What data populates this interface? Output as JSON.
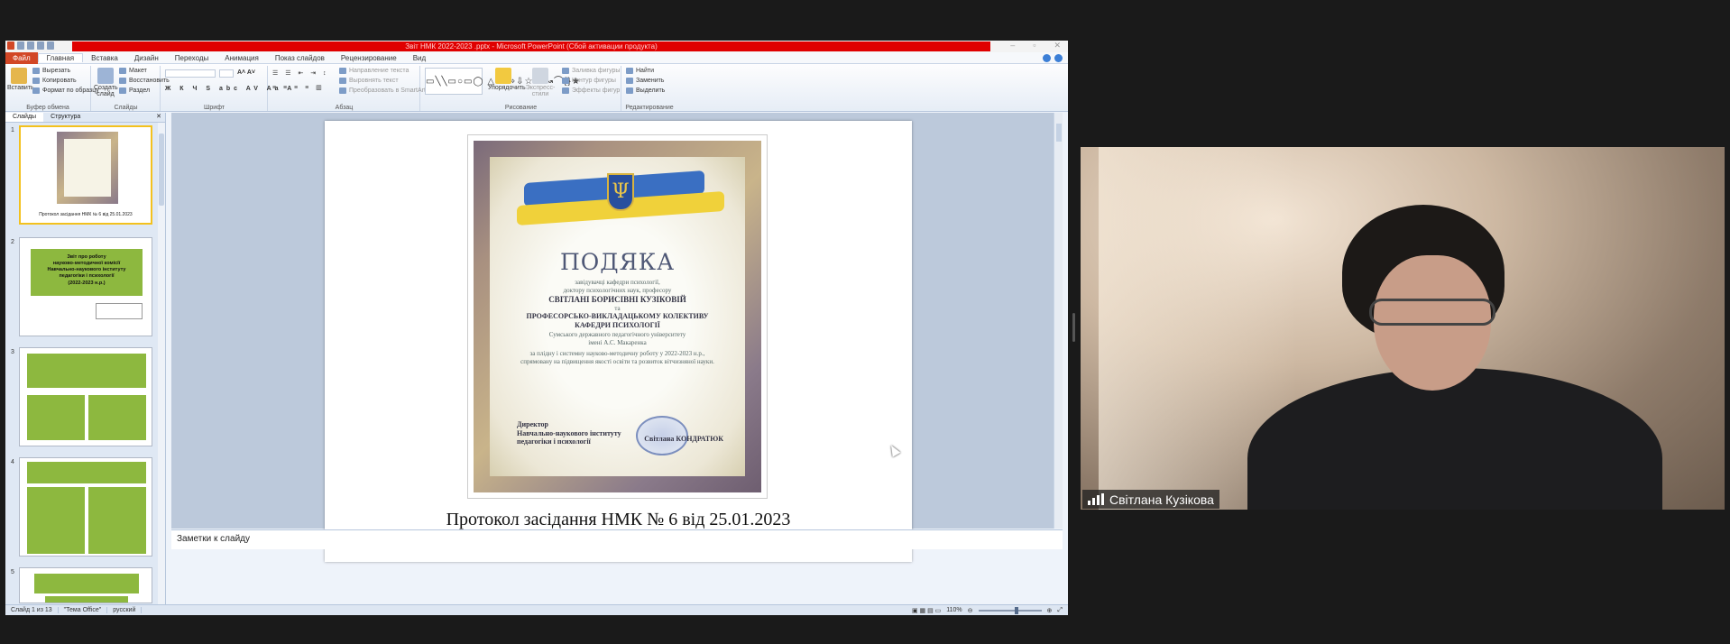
{
  "window": {
    "title": "Звіт НМК 2022-2023 .pptx - Microsoft PowerPoint (Сбой активации продукта)"
  },
  "menu": {
    "file": "Файл",
    "tabs": [
      "Главная",
      "Вставка",
      "Дизайн",
      "Переходы",
      "Анимация",
      "Показ слайдов",
      "Рецензирование",
      "Вид"
    ]
  },
  "ribbon": {
    "clipboard": {
      "label": "Буфер обмена",
      "paste": "Вставить",
      "cut": "Вырезать",
      "copy": "Копировать",
      "format_painter": "Формат по образцу"
    },
    "slides": {
      "label": "Слайды",
      "new_slide": "Создать слайд",
      "layout": "Макет",
      "reset": "Восстановить",
      "section": "Раздел"
    },
    "font": {
      "label": "Шрифт"
    },
    "paragraph": {
      "label": "Абзац",
      "text_direction": "Направление текста",
      "align_text": "Выровнять текст",
      "smartart": "Преобразовать в SmartArt"
    },
    "drawing": {
      "label": "Рисование",
      "arrange": "Упорядочить",
      "quick_styles": "Экспресс-стили",
      "fill": "Заливка фигуры",
      "outline": "Контур фигуры",
      "effects": "Эффекты фигур"
    },
    "editing": {
      "label": "Редактирование",
      "find": "Найти",
      "replace": "Заменить",
      "select": "Выделить"
    }
  },
  "pane": {
    "tab_slides": "Слайды",
    "tab_outline": "Структура",
    "thumbs": [
      {
        "num": "1",
        "caption": "Протокол засідання НМК № 6 від 25.01.2023"
      },
      {
        "num": "2",
        "lines": [
          "Звіт про роботу",
          "науково-методичної комісії",
          "Навчально-наукового інституту",
          "педагогіки і психології",
          "(2022-2023 н.р.)"
        ]
      },
      {
        "num": "3"
      },
      {
        "num": "4"
      },
      {
        "num": "5"
      }
    ]
  },
  "slide": {
    "cert": {
      "title": "ПОДЯКА",
      "line1": "завідувачці кафедри психології,",
      "line2": "доктору психологічних наук, професору",
      "name": "СВІТЛАНІ БОРИСІВНІ КУЗІКОВІЙ",
      "and": "та",
      "collective": "ПРОФЕСОРСЬКО-ВИКЛАДАЦЬКОМУ КОЛЕКТИВУ",
      "dept": "КАФЕДРИ ПСИХОЛОГІЇ",
      "univ1": "Сумського державного педагогічного університету",
      "univ2": "імені А.С. Макаренка",
      "reason1": "за плідну і системну науково-методичну роботу у 2022-2023 н.р.,",
      "reason2": "спрямовану на підвищення якості освіти та розвиток вітчизняної науки.",
      "director1": "Директор",
      "director2": "Навчально-наукового інституту",
      "director3": "педагогіки і психології",
      "signature": "Світлана КОНДРАТЮК"
    },
    "caption": "Протокол засідання НМК № 6 від 25.01.2023"
  },
  "notes": {
    "placeholder": "Заметки к слайду"
  },
  "status": {
    "slide_of": "Слайд 1 из 13",
    "theme": "\"Тема Office\"",
    "lang": "русский",
    "zoom": "110%"
  },
  "participant": {
    "name": "Світлана Кузікова"
  },
  "colors": {
    "accent_red": "#e00000",
    "file_tab": "#d24726",
    "thumb_green": "#8db83f"
  }
}
